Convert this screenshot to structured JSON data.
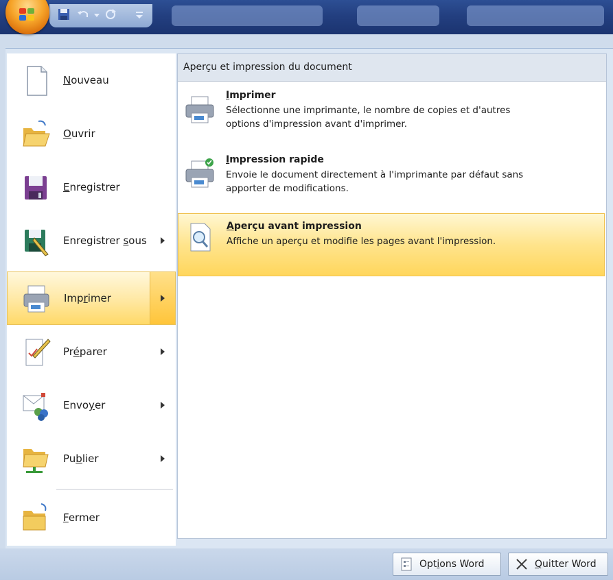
{
  "left_menu": {
    "items": [
      {
        "id": "nouveau",
        "label_pre": "",
        "label_u": "N",
        "label_post": "ouveau",
        "has_submenu": false
      },
      {
        "id": "ouvrir",
        "label_pre": "",
        "label_u": "O",
        "label_post": "uvrir",
        "has_submenu": false
      },
      {
        "id": "enregistrer",
        "label_pre": "",
        "label_u": "E",
        "label_post": "nregistrer",
        "has_submenu": false
      },
      {
        "id": "enregistrer-sous",
        "label_pre": "Enregistrer ",
        "label_u": "s",
        "label_post": "ous",
        "has_submenu": true
      },
      {
        "id": "imprimer",
        "label_pre": "Imp",
        "label_u": "r",
        "label_post": "imer",
        "has_submenu": true,
        "active": true
      },
      {
        "id": "preparer",
        "label_pre": "Pr",
        "label_u": "é",
        "label_post": "parer",
        "has_submenu": true
      },
      {
        "id": "envoyer",
        "label_pre": "Envo",
        "label_u": "y",
        "label_post": "er",
        "has_submenu": true
      },
      {
        "id": "publier",
        "label_pre": "Pu",
        "label_u": "b",
        "label_post": "lier",
        "has_submenu": true
      },
      {
        "id": "fermer",
        "label_pre": "",
        "label_u": "F",
        "label_post": "ermer",
        "has_submenu": false
      }
    ]
  },
  "submenu": {
    "header": "Aperçu et impression du document",
    "items": [
      {
        "title_pre": "",
        "title_u": "I",
        "title_post": "mprimer",
        "desc_line1": "Sélectionne une imprimante, le nombre de copies et d'autres",
        "desc_line2": "options d'impression avant d'imprimer.",
        "icon": "printer-icon"
      },
      {
        "title_pre": "",
        "title_u": "I",
        "title_post": "mpression rapide",
        "desc_line1": "Envoie le document directement à l'imprimante par défaut sans",
        "desc_line2": "apporter de modifications.",
        "icon": "quick-print-icon"
      },
      {
        "title_pre": "",
        "title_u": "A",
        "title_post": "perçu avant impression",
        "desc_line1": "Affiche un aperçu et modifie les pages avant l'impression.",
        "desc_line2": "",
        "icon": "print-preview-icon",
        "highlighted": true
      }
    ]
  },
  "bottom": {
    "options_pre": "Opt",
    "options_u": "i",
    "options_post": "ons Word",
    "quit_pre": "",
    "quit_u": "Q",
    "quit_post": "uitter Word"
  },
  "colors": {
    "highlight": "#ffd968",
    "title_bar": "#233f80",
    "office_orb": "#f6a429"
  }
}
